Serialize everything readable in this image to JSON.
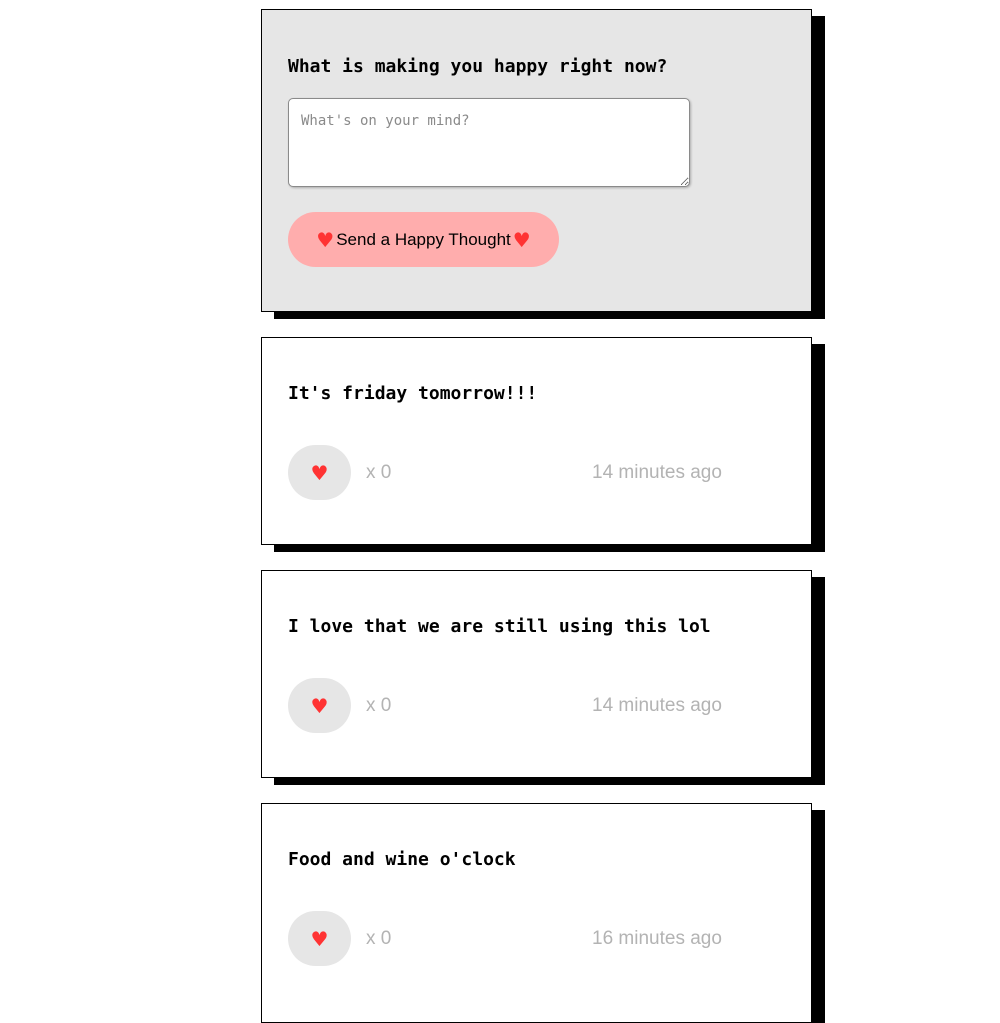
{
  "form": {
    "title": "What is making you happy right now?",
    "placeholder": "What's on your mind?",
    "value": "",
    "send_label": "Send a Happy Thought",
    "heart_icon": "heart-icon"
  },
  "thoughts": [
    {
      "message": "It's friday tomorrow!!!",
      "likes": "x 0",
      "time": "14 minutes ago"
    },
    {
      "message": "I love that we are still using this lol",
      "likes": "x 0",
      "time": "14 minutes ago"
    },
    {
      "message": "Food and wine o'clock",
      "likes": "x 0",
      "time": "16 minutes ago"
    }
  ],
  "colors": {
    "form_background": "#e6e6e6",
    "send_button": "#ffadad",
    "heart": "#ff3333",
    "like_button": "#e6e6e6",
    "muted_text": "#b3b3b3",
    "shadow": "#000000"
  }
}
